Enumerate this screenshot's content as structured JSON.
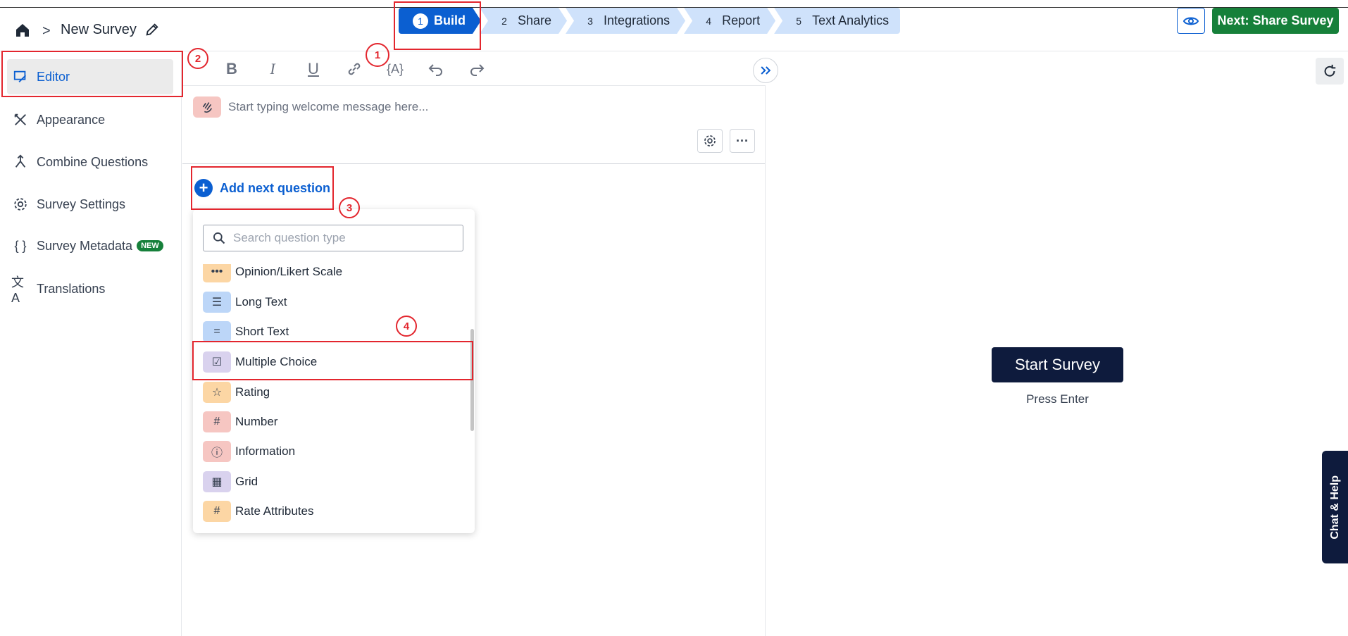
{
  "header": {
    "title": "New Survey",
    "breadcrumb_separator": ">",
    "steps": [
      {
        "num": "1",
        "label": "Build",
        "active": true
      },
      {
        "num": "2",
        "label": "Share",
        "active": false
      },
      {
        "num": "3",
        "label": "Integrations",
        "active": false
      },
      {
        "num": "4",
        "label": "Report",
        "active": false
      },
      {
        "num": "5",
        "label": "Text Analytics",
        "active": false
      }
    ],
    "next_button": "Next: Share Survey"
  },
  "sidebar": {
    "items": [
      {
        "label": "Editor",
        "icon": "editor-icon",
        "active": true
      },
      {
        "label": "Appearance",
        "icon": "brush-icon"
      },
      {
        "label": "Combine Questions",
        "icon": "merge-icon"
      },
      {
        "label": "Survey Settings",
        "icon": "gear-icon"
      },
      {
        "label": "Survey Metadata",
        "icon": "braces-icon",
        "badge": "NEW"
      },
      {
        "label": "Translations",
        "icon": "translate-icon"
      }
    ]
  },
  "editor": {
    "welcome_placeholder": "Start typing welcome message here...",
    "add_question": "Add next question",
    "more_label": "···"
  },
  "question_menu": {
    "search_placeholder": "Search question type",
    "items": [
      {
        "label": "Opinion/Likert Scale",
        "icon": "dots-icon",
        "color": "#fcd6a4"
      },
      {
        "label": "Long Text",
        "icon": "lines-icon",
        "color": "#bcd6f8"
      },
      {
        "label": "Short Text",
        "icon": "short-lines-icon",
        "color": "#bcd6f8"
      },
      {
        "label": "Multiple Choice",
        "icon": "checklist-icon",
        "color": "#d9d2ee"
      },
      {
        "label": "Rating",
        "icon": "star-icon",
        "color": "#fcd6a4"
      },
      {
        "label": "Number",
        "icon": "hash-icon",
        "color": "#f6c6c2"
      },
      {
        "label": "Information",
        "icon": "info-icon",
        "color": "#f6c6c2"
      },
      {
        "label": "Grid",
        "icon": "grid-icon",
        "color": "#d9d2ee"
      },
      {
        "label": "Rate Attributes",
        "icon": "hash-grid-icon",
        "color": "#fcd6a4"
      }
    ]
  },
  "preview": {
    "start_button": "Start Survey",
    "hint": "Press Enter",
    "chat_help": "Chat & Help"
  },
  "annotations": [
    "1",
    "2",
    "3",
    "4"
  ]
}
